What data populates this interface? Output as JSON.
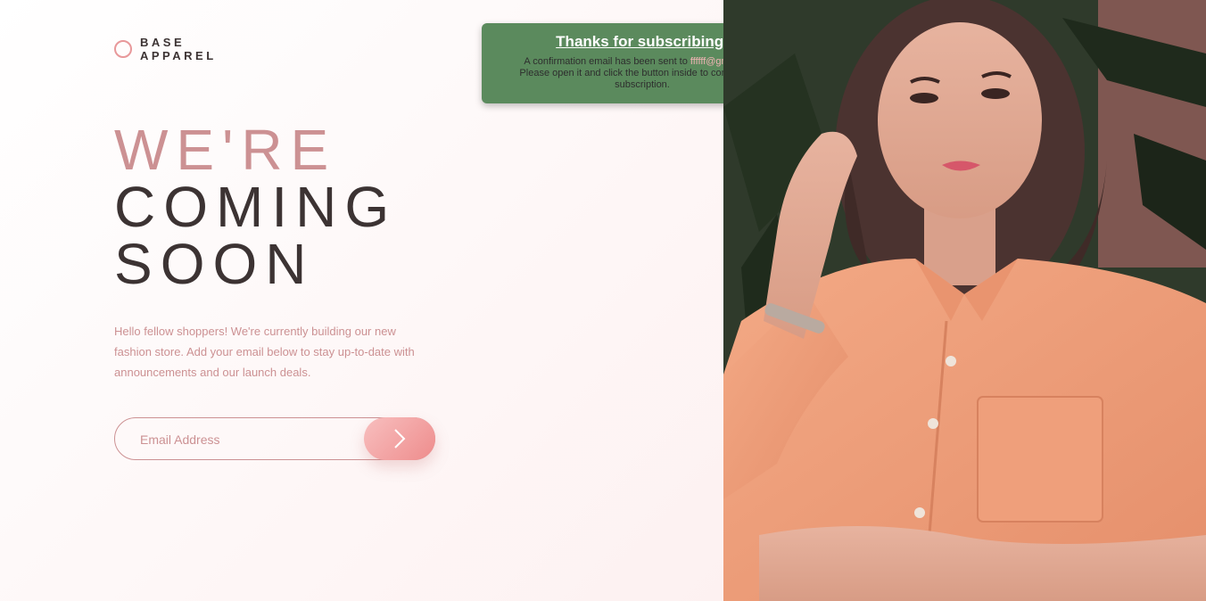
{
  "brand": {
    "line1": "BASE",
    "line2": "APPAREL"
  },
  "headline": {
    "line1": "WE'RE",
    "line2": "COMING",
    "line3": "SOON"
  },
  "intro": "Hello fellow shoppers! We're currently building our new fashion store. Add your email below to stay up-to-date with announcements and our launch deals.",
  "form": {
    "placeholder": "Email Address",
    "value": ""
  },
  "toast": {
    "title": "Thanks for subscribing!",
    "body_before": "A confirmation email has been sent to ",
    "email": "ffffff@gmail.com",
    "body_after": "Please open it and click the button inside to confirm your subscription."
  },
  "colors": {
    "accent": "#cc9193",
    "dark_text": "#3c3333",
    "toast_bg": "#5b8a5d",
    "button_gradient_start": "#f8bfbf",
    "button_gradient_end": "#ee8c8c"
  },
  "icons": {
    "logo": "logo-circle-icon",
    "submit": "arrow-right-icon"
  },
  "hero_image": {
    "alt": "Woman in orange shirt"
  }
}
